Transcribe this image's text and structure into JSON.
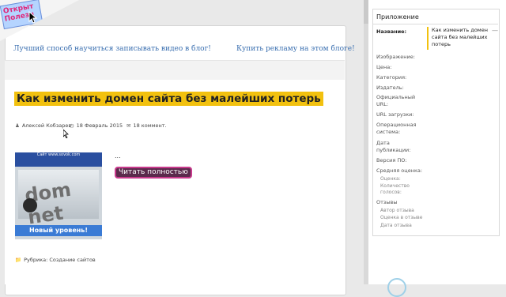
{
  "logo": {
    "line1": "Открыт",
    "line2": "Полезн"
  },
  "promo": {
    "left": "Лучший способ научиться записывать видео в блог!",
    "right": "Купить рекламу на этом блоге!"
  },
  "post": {
    "title": "Как изменить домен сайта без малейших потерь",
    "author": "Алексей Кобзарев",
    "date": "18 Февраль 2015",
    "comments": "18 коммент.",
    "excerpt": "...",
    "read_more": "Читать полностью",
    "category": "Рубрика: Создание сайтов",
    "thumbnail": {
      "top_text": "Сайт www.sovok.com",
      "main_text": "dom net",
      "bottom_text": "Новый уровень!"
    }
  },
  "panel": {
    "title": "Приложение",
    "name_label": "Название:",
    "name_value": "Как изменить домен сайта без малейших потерь",
    "fields": [
      "Изображение:",
      "Цена:",
      "Категория:",
      "Издатель:",
      "Официальный URL:",
      "URL загрузки:",
      "Операционная система:",
      "Дата публикации:",
      "Версия ПО:",
      "Средняя оценка:"
    ],
    "rating_sub": [
      "Оценка:",
      "Количество голосов:"
    ],
    "reviews_label": "Отзывы",
    "reviews_sub": [
      "Автор отзыва",
      "Оценка в отзыве",
      "Дата отзыва"
    ]
  },
  "icons": {
    "author": "user-icon",
    "date": "clock-icon",
    "comments": "comments-icon",
    "category": "folder-icon"
  }
}
